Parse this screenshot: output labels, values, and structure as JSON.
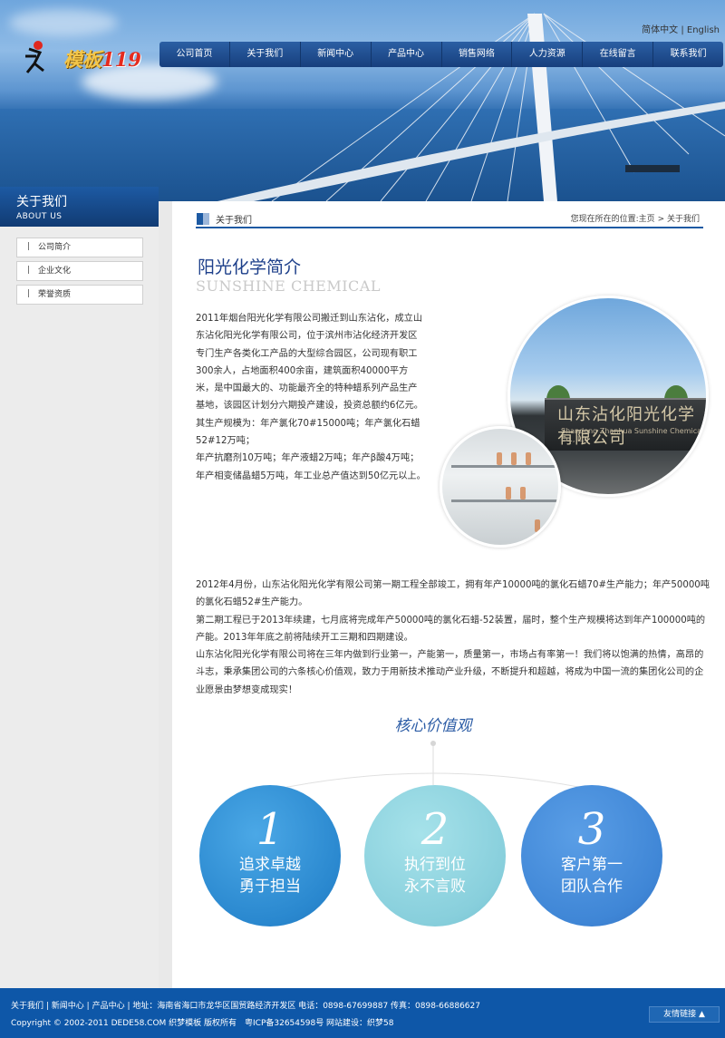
{
  "header": {
    "logo_text_a": "模板",
    "logo_text_b": "119",
    "lang": {
      "cn": "简体中文",
      "sep": "|",
      "en": "English"
    },
    "nav": [
      "公司首页",
      "关于我们",
      "新闻中心",
      "产品中心",
      "销售网络",
      "人力资源",
      "在线留言",
      "联系我们"
    ]
  },
  "sidebar": {
    "title_cn": "关于我们",
    "title_en": "ABOUT US",
    "items": [
      {
        "label": "公司简介"
      },
      {
        "label": "企业文化"
      },
      {
        "label": "荣誉资质"
      }
    ]
  },
  "breadcrumb": {
    "section": "关于我们",
    "prefix": "您现在所在的位置:",
    "home": "主页",
    "sep": ">",
    "current": "关于我们"
  },
  "article": {
    "title": "阳光化学简介",
    "title_en": "SUNSHINE CHEMICAL",
    "para1": [
      "2011年烟台阳光化学有限公司搬迁到山东沾化，成立山东沾化阳光化学有限公司，位于滨州市沾化经济开发区专门生产各类化工产品的大型综合园区，公司现有职工300余人，占地面积400余亩，建筑面积40000平方米，是中国最大的、功能最齐全的特种蜡系列产品生产基地，该园区计划分六期投产建设，投资总额约6亿元。",
      "其生产规模为：年产氯化70#15000吨；年产氯化石蜡52#12万吨；",
      "年产抗磨剂10万吨；年产液蜡2万吨；年产β酸4万吨； 年产相变储晶蜡5万吨，年工业总产值达到50亿元以上。"
    ],
    "photo_sign_cn": "山东沾化阳光化学有限公司",
    "photo_sign_en": "Shandong Zhanhua Sunshine Chemical Co., Ltd",
    "para2": [
      "2012年4月份，山东沾化阳光化学有限公司第一期工程全部竣工，拥有年产10000吨的氯化石蜡70#生产能力；年产50000吨的氯化石蜡52#生产能力。",
      "第二期工程已于2013年续建，七月底将完成年产50000吨的氯化石蜡-52装置，届时，整个生产规模将达到年产100000吨的产能。2013年年底之前将陆续开工三期和四期建设。",
      "山东沾化阳光化学有限公司将在三年内做到行业第一，产能第一，质量第一，市场占有率第一！我们将以饱满的热情，高昂的斗志，秉承集团公司的六条核心价值观，致力于用新技术推动产业升级，不断提升和超越，将成为中国一流的集团化公司的企业愿景由梦想变成现实！"
    ]
  },
  "values": {
    "title": "核心价值观",
    "items": [
      {
        "num": "1",
        "line1": "追求卓越",
        "line2": "勇于担当"
      },
      {
        "num": "2",
        "line1": "执行到位",
        "line2": "永不言败"
      },
      {
        "num": "3",
        "line1": "客户第一",
        "line2": "团队合作"
      }
    ]
  },
  "footer": {
    "links": [
      "关于我们",
      "新闻中心",
      "产品中心"
    ],
    "address": "地址：海南省海口市龙华区国贸路经济开发区 电话：0898-67699887 传真：0898-66886627",
    "copyright": "Copyright © 2002-2011 DEDE58.COM 织梦模板 版权所有　粤ICP备32654598号 网站建设：织梦58",
    "friend_links": "友情链接 ▲"
  },
  "colors": {
    "primary": "#1d5aa3",
    "footer": "#0e57a8",
    "title_blue": "#1d3f8a",
    "circle1": "#2a88cf",
    "circle2": "#88cfdc",
    "circle3": "#3f86d6"
  }
}
